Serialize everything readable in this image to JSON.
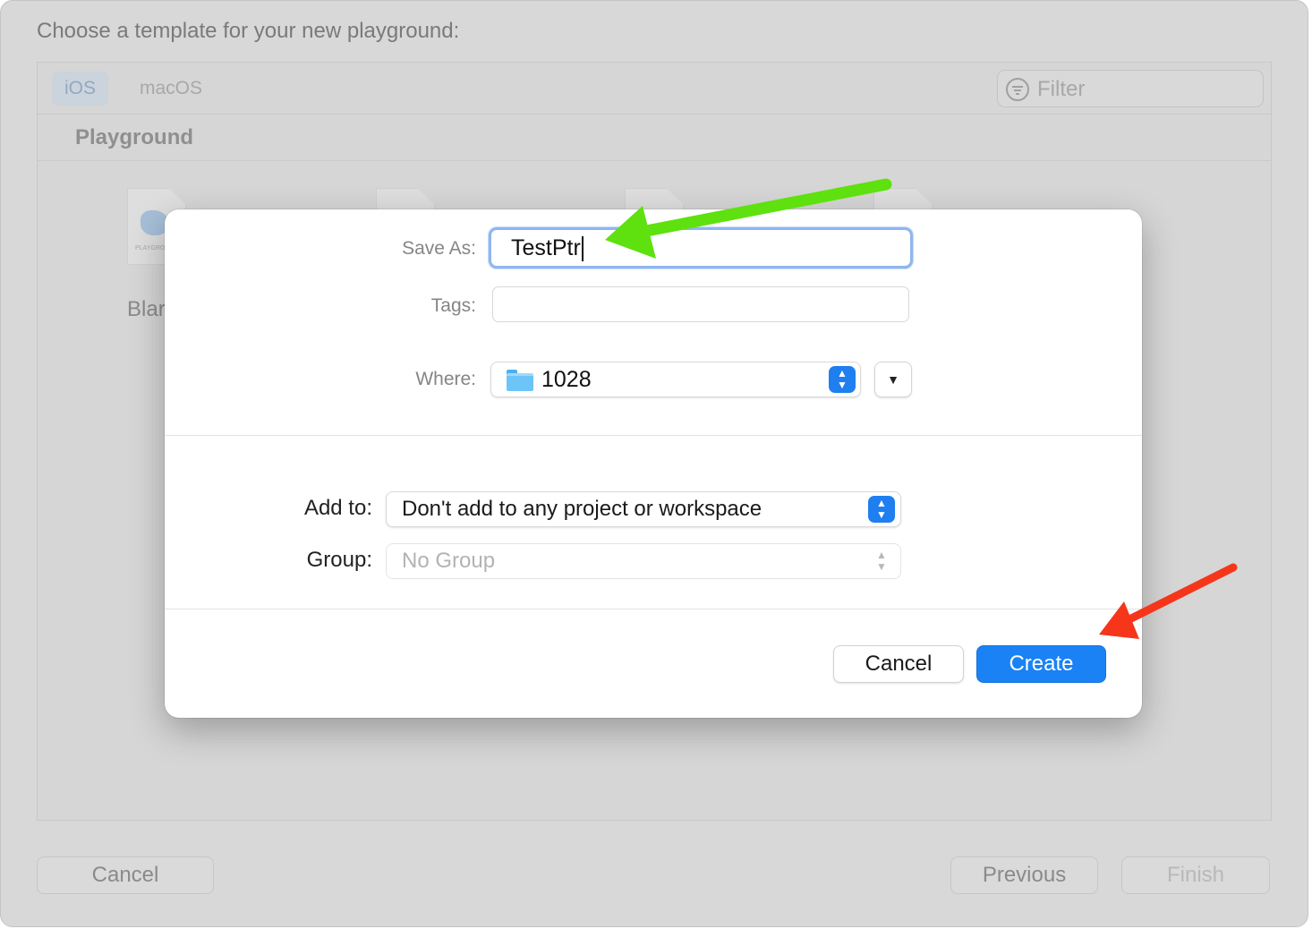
{
  "background": {
    "title": "Choose a template for your new playground:",
    "tabs": [
      {
        "label": "iOS",
        "active": true
      },
      {
        "label": "macOS",
        "active": false
      }
    ],
    "filter_placeholder": "Filter",
    "section_label": "Playground",
    "doc_label": "PLAYGRO",
    "template_label": "Blar",
    "buttons": {
      "cancel": "Cancel",
      "previous": "Previous",
      "finish": "Finish"
    }
  },
  "sheet": {
    "save_as": {
      "label": "Save As:",
      "value": "TestPtr"
    },
    "tags": {
      "label": "Tags:",
      "value": ""
    },
    "where": {
      "label": "Where:",
      "value": "1028"
    },
    "add_to": {
      "label": "Add to:",
      "value": "Don't add to any project or workspace"
    },
    "group": {
      "label": "Group:",
      "value": "No Group"
    },
    "buttons": {
      "cancel": "Cancel",
      "create": "Create"
    }
  },
  "colors": {
    "accent": "#1a82f5",
    "annotation_green": "#5ee10f",
    "annotation_red": "#f5361b"
  },
  "icons": {
    "filter": "filter-icon",
    "folder": "folder-icon",
    "stepper": "up-down-chevron-icon",
    "expand": "chevron-down-icon"
  }
}
